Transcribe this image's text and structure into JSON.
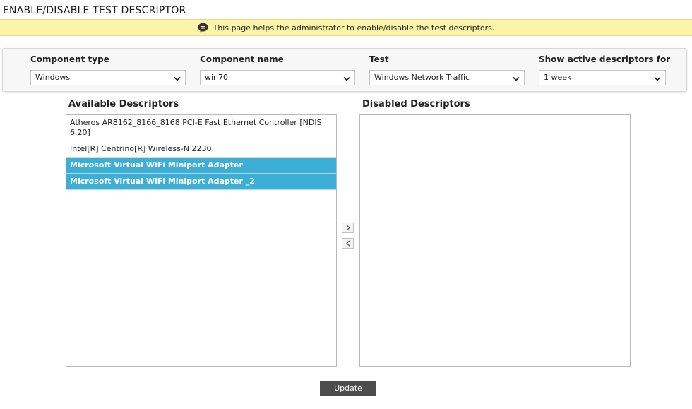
{
  "page": {
    "title": "ENABLE/DISABLE TEST DESCRIPTOR",
    "info_message": "This page helps the administrator to enable/disable the test descriptors."
  },
  "filters": {
    "component_type": {
      "label": "Component type",
      "value": "Windows"
    },
    "component_name": {
      "label": "Component name",
      "value": "win70"
    },
    "test": {
      "label": "Test",
      "value": "Windows Network Traffic"
    },
    "active_for": {
      "label": "Show active descriptors for",
      "value": "1 week"
    }
  },
  "available": {
    "label": "Available Descriptors",
    "items": [
      {
        "text": "Atheros AR8162_8166_8168 PCI-E Fast Ethernet Controller [NDIS 6.20]",
        "selected": false
      },
      {
        "text": "Intel[R] Centrino[R] Wireless-N 2230",
        "selected": false
      },
      {
        "text": "Microsoft Virtual WiFi Miniport Adapter",
        "selected": true
      },
      {
        "text": "Microsoft Virtual WiFi Miniport Adapter _2",
        "selected": true
      }
    ]
  },
  "disabled": {
    "label": "Disabled Descriptors",
    "items": []
  },
  "actions": {
    "update_label": "Update"
  },
  "icons": {
    "info": "speech-bubble-icon",
    "dropdown": "chevron-down-icon",
    "move_right": "chevron-right-icon",
    "move_left": "chevron-left-icon"
  },
  "colors": {
    "banner_bg": "#fbf3a8",
    "selected_item": "#3daed6",
    "update_button": "#4d4d4d"
  }
}
